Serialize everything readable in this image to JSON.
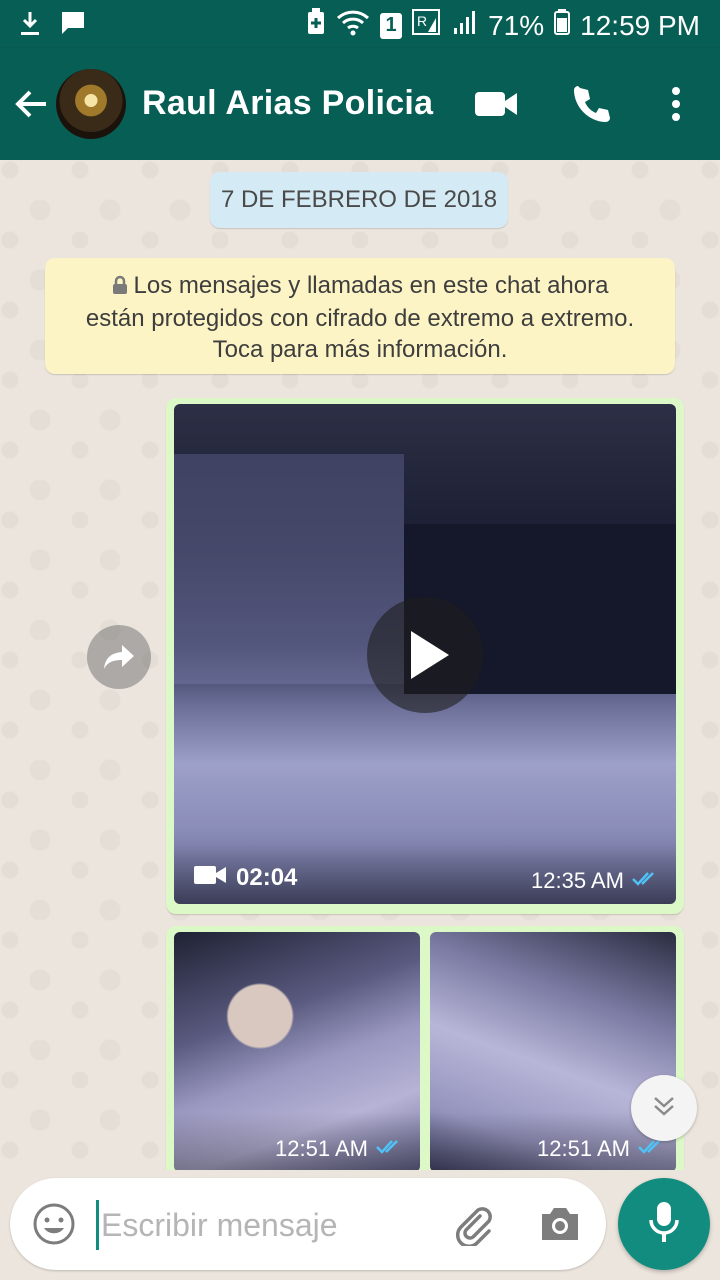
{
  "status_bar": {
    "battery": "71%",
    "time": "12:59 PM",
    "sim_label": "1"
  },
  "header": {
    "contact_name": "Raul Arias Policia",
    "icons": [
      "back-arrow-icon",
      "video-call-icon",
      "phone-icon",
      "more-vert-icon"
    ]
  },
  "chat": {
    "date_chip": "7 DE FEBRERO DE 2018",
    "encryption_notice": {
      "line1": "Los mensajes y llamadas en este chat ahora",
      "line2": "están protegidos con cifrado de extremo a extremo.",
      "line3": "Toca para más información."
    },
    "messages": [
      {
        "type": "video",
        "duration": "02:04",
        "time": "12:35 AM",
        "status": "read"
      },
      {
        "type": "photos",
        "items": [
          {
            "time": "12:51 AM",
            "status": "read"
          },
          {
            "time": "12:51 AM",
            "status": "read"
          }
        ]
      }
    ]
  },
  "composer": {
    "placeholder": "Escribir mensaje",
    "value": ""
  },
  "colors": {
    "primary": "#075e54",
    "accent": "#128c7e",
    "outgoing_bubble": "#dcf8c6",
    "read_ticks": "#4fc3f7"
  }
}
